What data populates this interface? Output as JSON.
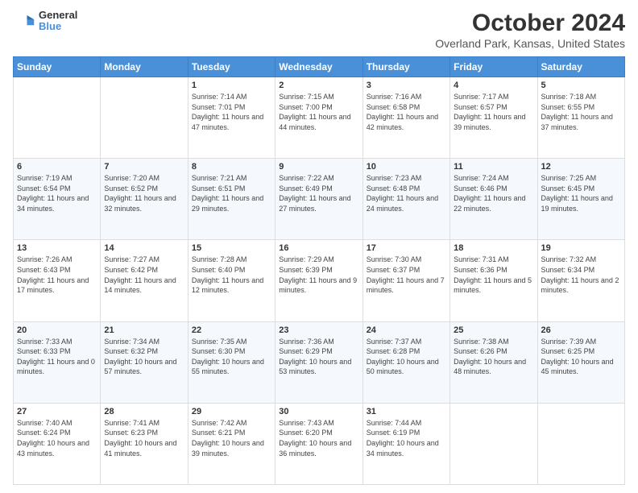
{
  "header": {
    "logo_line1": "General",
    "logo_line2": "Blue",
    "title": "October 2024",
    "subtitle": "Overland Park, Kansas, United States"
  },
  "weekdays": [
    "Sunday",
    "Monday",
    "Tuesday",
    "Wednesday",
    "Thursday",
    "Friday",
    "Saturday"
  ],
  "weeks": [
    [
      {
        "day": "",
        "sunrise": "",
        "sunset": "",
        "daylight": ""
      },
      {
        "day": "",
        "sunrise": "",
        "sunset": "",
        "daylight": ""
      },
      {
        "day": "1",
        "sunrise": "Sunrise: 7:14 AM",
        "sunset": "Sunset: 7:01 PM",
        "daylight": "Daylight: 11 hours and 47 minutes."
      },
      {
        "day": "2",
        "sunrise": "Sunrise: 7:15 AM",
        "sunset": "Sunset: 7:00 PM",
        "daylight": "Daylight: 11 hours and 44 minutes."
      },
      {
        "day": "3",
        "sunrise": "Sunrise: 7:16 AM",
        "sunset": "Sunset: 6:58 PM",
        "daylight": "Daylight: 11 hours and 42 minutes."
      },
      {
        "day": "4",
        "sunrise": "Sunrise: 7:17 AM",
        "sunset": "Sunset: 6:57 PM",
        "daylight": "Daylight: 11 hours and 39 minutes."
      },
      {
        "day": "5",
        "sunrise": "Sunrise: 7:18 AM",
        "sunset": "Sunset: 6:55 PM",
        "daylight": "Daylight: 11 hours and 37 minutes."
      }
    ],
    [
      {
        "day": "6",
        "sunrise": "Sunrise: 7:19 AM",
        "sunset": "Sunset: 6:54 PM",
        "daylight": "Daylight: 11 hours and 34 minutes."
      },
      {
        "day": "7",
        "sunrise": "Sunrise: 7:20 AM",
        "sunset": "Sunset: 6:52 PM",
        "daylight": "Daylight: 11 hours and 32 minutes."
      },
      {
        "day": "8",
        "sunrise": "Sunrise: 7:21 AM",
        "sunset": "Sunset: 6:51 PM",
        "daylight": "Daylight: 11 hours and 29 minutes."
      },
      {
        "day": "9",
        "sunrise": "Sunrise: 7:22 AM",
        "sunset": "Sunset: 6:49 PM",
        "daylight": "Daylight: 11 hours and 27 minutes."
      },
      {
        "day": "10",
        "sunrise": "Sunrise: 7:23 AM",
        "sunset": "Sunset: 6:48 PM",
        "daylight": "Daylight: 11 hours and 24 minutes."
      },
      {
        "day": "11",
        "sunrise": "Sunrise: 7:24 AM",
        "sunset": "Sunset: 6:46 PM",
        "daylight": "Daylight: 11 hours and 22 minutes."
      },
      {
        "day": "12",
        "sunrise": "Sunrise: 7:25 AM",
        "sunset": "Sunset: 6:45 PM",
        "daylight": "Daylight: 11 hours and 19 minutes."
      }
    ],
    [
      {
        "day": "13",
        "sunrise": "Sunrise: 7:26 AM",
        "sunset": "Sunset: 6:43 PM",
        "daylight": "Daylight: 11 hours and 17 minutes."
      },
      {
        "day": "14",
        "sunrise": "Sunrise: 7:27 AM",
        "sunset": "Sunset: 6:42 PM",
        "daylight": "Daylight: 11 hours and 14 minutes."
      },
      {
        "day": "15",
        "sunrise": "Sunrise: 7:28 AM",
        "sunset": "Sunset: 6:40 PM",
        "daylight": "Daylight: 11 hours and 12 minutes."
      },
      {
        "day": "16",
        "sunrise": "Sunrise: 7:29 AM",
        "sunset": "Sunset: 6:39 PM",
        "daylight": "Daylight: 11 hours and 9 minutes."
      },
      {
        "day": "17",
        "sunrise": "Sunrise: 7:30 AM",
        "sunset": "Sunset: 6:37 PM",
        "daylight": "Daylight: 11 hours and 7 minutes."
      },
      {
        "day": "18",
        "sunrise": "Sunrise: 7:31 AM",
        "sunset": "Sunset: 6:36 PM",
        "daylight": "Daylight: 11 hours and 5 minutes."
      },
      {
        "day": "19",
        "sunrise": "Sunrise: 7:32 AM",
        "sunset": "Sunset: 6:34 PM",
        "daylight": "Daylight: 11 hours and 2 minutes."
      }
    ],
    [
      {
        "day": "20",
        "sunrise": "Sunrise: 7:33 AM",
        "sunset": "Sunset: 6:33 PM",
        "daylight": "Daylight: 11 hours and 0 minutes."
      },
      {
        "day": "21",
        "sunrise": "Sunrise: 7:34 AM",
        "sunset": "Sunset: 6:32 PM",
        "daylight": "Daylight: 10 hours and 57 minutes."
      },
      {
        "day": "22",
        "sunrise": "Sunrise: 7:35 AM",
        "sunset": "Sunset: 6:30 PM",
        "daylight": "Daylight: 10 hours and 55 minutes."
      },
      {
        "day": "23",
        "sunrise": "Sunrise: 7:36 AM",
        "sunset": "Sunset: 6:29 PM",
        "daylight": "Daylight: 10 hours and 53 minutes."
      },
      {
        "day": "24",
        "sunrise": "Sunrise: 7:37 AM",
        "sunset": "Sunset: 6:28 PM",
        "daylight": "Daylight: 10 hours and 50 minutes."
      },
      {
        "day": "25",
        "sunrise": "Sunrise: 7:38 AM",
        "sunset": "Sunset: 6:26 PM",
        "daylight": "Daylight: 10 hours and 48 minutes."
      },
      {
        "day": "26",
        "sunrise": "Sunrise: 7:39 AM",
        "sunset": "Sunset: 6:25 PM",
        "daylight": "Daylight: 10 hours and 45 minutes."
      }
    ],
    [
      {
        "day": "27",
        "sunrise": "Sunrise: 7:40 AM",
        "sunset": "Sunset: 6:24 PM",
        "daylight": "Daylight: 10 hours and 43 minutes."
      },
      {
        "day": "28",
        "sunrise": "Sunrise: 7:41 AM",
        "sunset": "Sunset: 6:23 PM",
        "daylight": "Daylight: 10 hours and 41 minutes."
      },
      {
        "day": "29",
        "sunrise": "Sunrise: 7:42 AM",
        "sunset": "Sunset: 6:21 PM",
        "daylight": "Daylight: 10 hours and 39 minutes."
      },
      {
        "day": "30",
        "sunrise": "Sunrise: 7:43 AM",
        "sunset": "Sunset: 6:20 PM",
        "daylight": "Daylight: 10 hours and 36 minutes."
      },
      {
        "day": "31",
        "sunrise": "Sunrise: 7:44 AM",
        "sunset": "Sunset: 6:19 PM",
        "daylight": "Daylight: 10 hours and 34 minutes."
      },
      {
        "day": "",
        "sunrise": "",
        "sunset": "",
        "daylight": ""
      },
      {
        "day": "",
        "sunrise": "",
        "sunset": "",
        "daylight": ""
      }
    ]
  ]
}
